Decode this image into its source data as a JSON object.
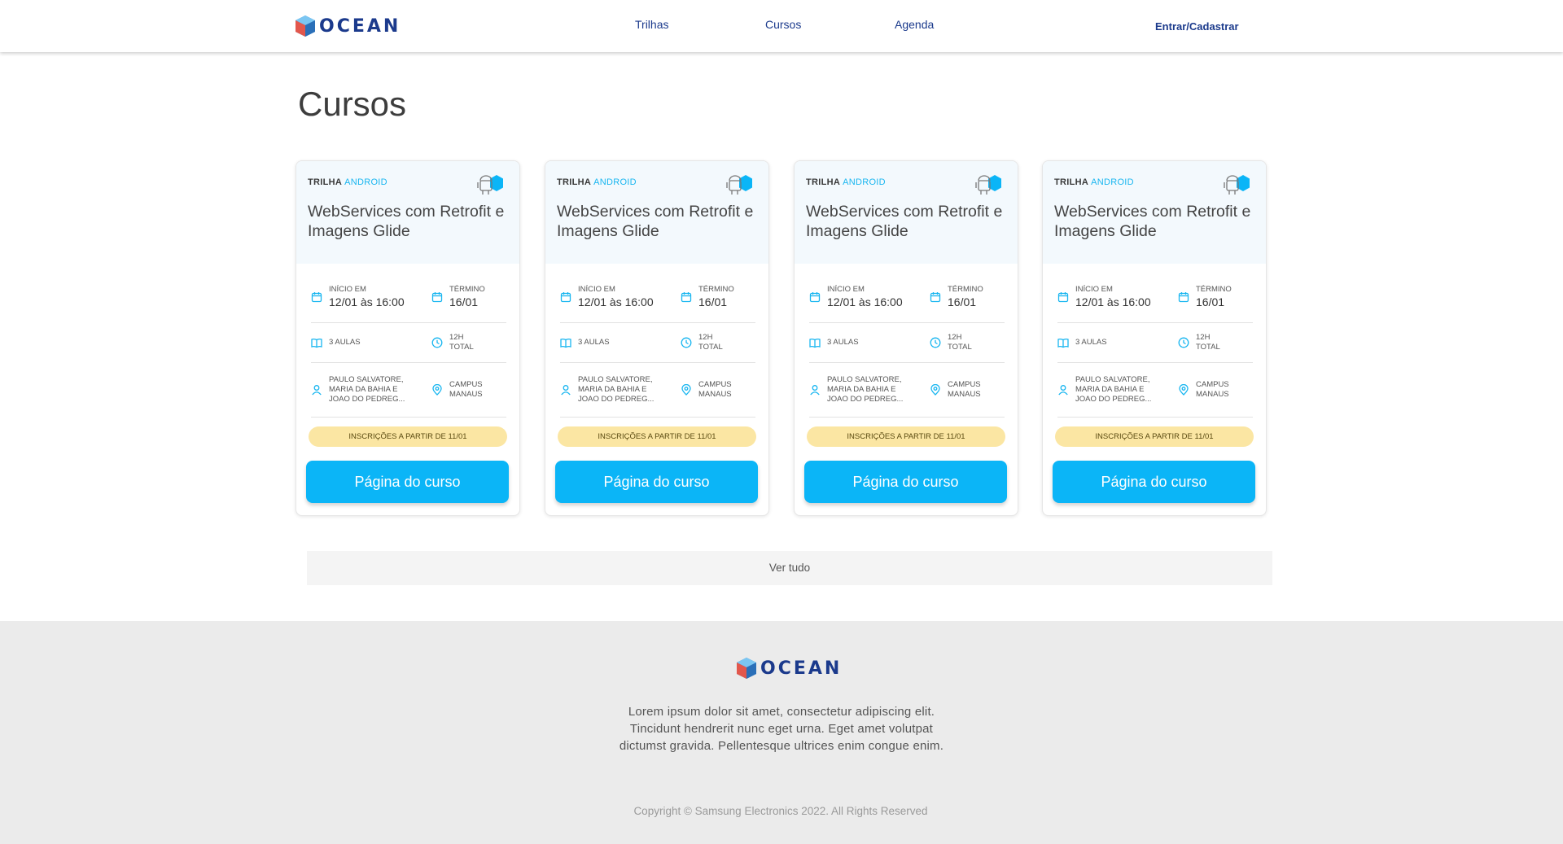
{
  "header": {
    "logo_text": "OCEAN",
    "nav": [
      "Trilhas",
      "Cursos",
      "Agenda"
    ],
    "login": "Entrar/Cadastrar"
  },
  "page_title": "Cursos",
  "cards": [
    {
      "track_prefix": "TRILHA",
      "track_name": "ANDROID",
      "title": "WebServices com Retrofit e Imagens Glide",
      "start_label": "INÍCIO EM",
      "start_value": "12/01 às 16:00",
      "end_label": "TÉRMINO",
      "end_value": "16/01",
      "lessons": "3 AULAS",
      "duration_line1": "12H",
      "duration_line2": "TOTAL",
      "instructors_line1": "PAULO SALVATORE,",
      "instructors_line2": "MARIA DA BAHIA E",
      "instructors_line3": "JOAO DO PEDREG...",
      "location_line1": "CAMPUS",
      "location_line2": "MANAUS",
      "badge": "INSCRIÇÕES A PARTIR DE 11/01",
      "button": "Página do curso"
    },
    {
      "track_prefix": "TRILHA",
      "track_name": "ANDROID",
      "title": "WebServices com Retrofit e Imagens Glide",
      "start_label": "INÍCIO EM",
      "start_value": "12/01 às 16:00",
      "end_label": "TÉRMINO",
      "end_value": "16/01",
      "lessons": "3 AULAS",
      "duration_line1": "12H",
      "duration_line2": "TOTAL",
      "instructors_line1": "PAULO SALVATORE,",
      "instructors_line2": "MARIA DA BAHIA E",
      "instructors_line3": "JOAO DO PEDREG...",
      "location_line1": "CAMPUS",
      "location_line2": "MANAUS",
      "badge": "INSCRIÇÕES A PARTIR DE 11/01",
      "button": "Página do curso"
    },
    {
      "track_prefix": "TRILHA",
      "track_name": "ANDROID",
      "title": "WebServices com Retrofit e Imagens Glide",
      "start_label": "INÍCIO EM",
      "start_value": "12/01 às 16:00",
      "end_label": "TÉRMINO",
      "end_value": "16/01",
      "lessons": "3 AULAS",
      "duration_line1": "12H",
      "duration_line2": "TOTAL",
      "instructors_line1": "PAULO SALVATORE,",
      "instructors_line2": "MARIA DA BAHIA E",
      "instructors_line3": "JOAO DO PEDREG...",
      "location_line1": "CAMPUS",
      "location_line2": "MANAUS",
      "badge": "INSCRIÇÕES A PARTIR DE 11/01",
      "button": "Página do curso"
    },
    {
      "track_prefix": "TRILHA",
      "track_name": "ANDROID",
      "title": "WebServices com Retrofit e Imagens Glide",
      "start_label": "INÍCIO EM",
      "start_value": "12/01 às 16:00",
      "end_label": "TÉRMINO",
      "end_value": "16/01",
      "lessons": "3 AULAS",
      "duration_line1": "12H",
      "duration_line2": "TOTAL",
      "instructors_line1": "PAULO SALVATORE,",
      "instructors_line2": "MARIA DA BAHIA E",
      "instructors_line3": "JOAO DO PEDREG...",
      "location_line1": "CAMPUS",
      "location_line2": "MANAUS",
      "badge": "INSCRIÇÕES A PARTIR DE 11/01",
      "button": "Página do curso"
    }
  ],
  "see_all": "Ver tudo",
  "footer": {
    "logo_text": "OCEAN",
    "description": "Lorem ipsum dolor sit amet, consectetur adipiscing elit. Tincidunt hendrerit nunc eget urna. Eget amet volutpat dictumst gravida. Pellentesque ultrices enim congue enim.",
    "copyright": "Copyright © Samsung Electronics 2022. All Rights Reserved"
  },
  "colors": {
    "brand_navy": "#1b3a8c",
    "accent_blue": "#0bb5f7",
    "badge_yellow": "#fbe6a3",
    "footer_bg": "#ebebeb"
  },
  "icons": [
    "ocean-logo-icon",
    "android-track-icon",
    "calendar-icon",
    "book-icon",
    "clock-icon",
    "user-icon",
    "location-pin-icon"
  ]
}
